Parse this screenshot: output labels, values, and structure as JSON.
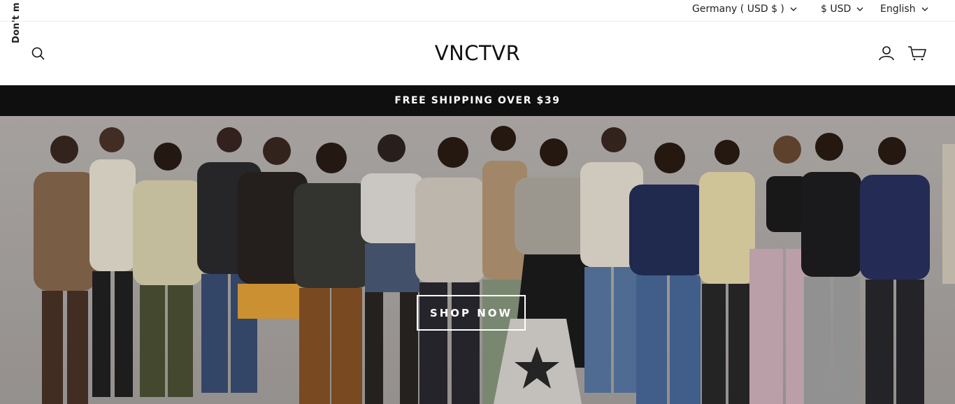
{
  "side_tab": {
    "label": "Don't m"
  },
  "topbar": {
    "country": "Germany ( USD $ )",
    "currency": "$ USD",
    "language": "English"
  },
  "header": {
    "logo": "VNCTVR",
    "icons": [
      "search-icon",
      "account-icon",
      "cart-icon"
    ]
  },
  "announcement": {
    "text": "FREE SHIPPING OVER $39"
  },
  "hero": {
    "cta_label": "SHOP NOW",
    "background_color": "#b6b1ae"
  }
}
